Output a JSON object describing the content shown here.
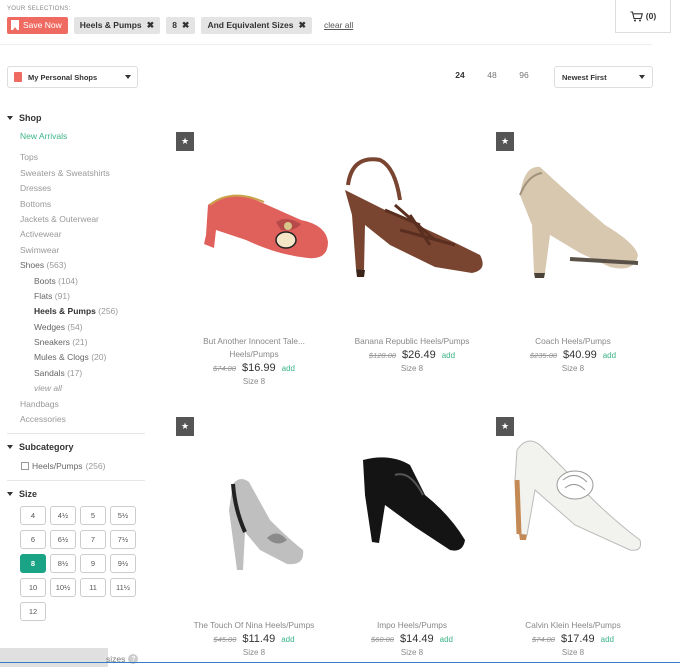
{
  "selections": {
    "title": "YOUR SELECTIONS:",
    "save_label": "Save Now",
    "chips": [
      {
        "label": "Heels & Pumps"
      },
      {
        "label": "8"
      },
      {
        "label": "And Equivalent Sizes"
      }
    ],
    "remove_symbol": "✖",
    "clear_label": "clear all"
  },
  "cart": {
    "count_label": "(0)",
    "icon": "cart-icon"
  },
  "shops_dropdown": {
    "label": "My Personal Shops"
  },
  "per_page": {
    "options": [
      "24",
      "48",
      "96"
    ],
    "active": "24"
  },
  "sort": {
    "label": "Newest First"
  },
  "sidebar": {
    "shop_title": "Shop",
    "categories": [
      {
        "label": "New Arrivals"
      },
      {
        "label": "Tops"
      },
      {
        "label": "Sweaters & Sweatshirts"
      },
      {
        "label": "Dresses"
      },
      {
        "label": "Bottoms"
      },
      {
        "label": "Jackets & Outerwear"
      },
      {
        "label": "Activewear"
      },
      {
        "label": "Swimwear"
      },
      {
        "label": "Shoes",
        "count": "(563)"
      },
      {
        "label": "Boots",
        "count": "(104)"
      },
      {
        "label": "Flats",
        "count": "(91)"
      },
      {
        "label": "Heels & Pumps",
        "count": "(256)"
      },
      {
        "label": "Wedges",
        "count": "(54)"
      },
      {
        "label": "Sneakers",
        "count": "(21)"
      },
      {
        "label": "Mules & Clogs",
        "count": "(20)"
      },
      {
        "label": "Sandals",
        "count": "(17)"
      },
      {
        "label": "view all"
      },
      {
        "label": "Handbags"
      },
      {
        "label": "Accessories"
      }
    ],
    "subcategory_title": "Subcategory",
    "subcategory_item": {
      "label": "Heels/Pumps",
      "count": "(256)"
    },
    "size_title": "Size",
    "sizes": [
      "4",
      "4½",
      "5",
      "5½",
      "6",
      "6½",
      "7",
      "7½",
      "8",
      "8½",
      "9",
      "9½",
      "10",
      "10½",
      "11",
      "11½",
      "12"
    ],
    "selected_size": "8",
    "footer_label": "sizes",
    "help_icon": "?"
  },
  "products": [
    {
      "name_line1": "But Another Innocent Tale...",
      "name_line2": "Heels/Pumps",
      "old_price": "$74.00",
      "price": "$16.99",
      "add": "add",
      "size": "Size 8",
      "shoe_color": "#e0605c"
    },
    {
      "name_line1": "Banana Republic Heels/Pumps",
      "name_line2": "",
      "old_price": "$128.00",
      "price": "$26.49",
      "add": "add",
      "size": "Size 8",
      "shoe_color": "#7a4530"
    },
    {
      "name_line1": "Coach Heels/Pumps",
      "name_line2": "",
      "old_price": "$235.00",
      "price": "$40.99",
      "add": "add",
      "size": "Size 8",
      "shoe_color": "#d8c8b0"
    },
    {
      "name_line1": "The Touch Of Nina Heels/Pumps",
      "name_line2": "",
      "old_price": "$45.00",
      "price": "$11.49",
      "add": "add",
      "size": "Size 8",
      "shoe_color": "#bfbfbf"
    },
    {
      "name_line1": "Impo Heels/Pumps",
      "name_line2": "",
      "old_price": "$60.00",
      "price": "$14.49",
      "add": "add",
      "size": "Size 8",
      "shoe_color": "#141414"
    },
    {
      "name_line1": "Calvin Klein Heels/Pumps",
      "name_line2": "",
      "old_price": "$74.00",
      "price": "$17.49",
      "add": "add",
      "size": "Size 8",
      "shoe_color": "#f2f2ee"
    }
  ],
  "colors": {
    "accent_green": "#1aa384",
    "save_red": "#ef6b61",
    "link_green": "#3db486"
  }
}
